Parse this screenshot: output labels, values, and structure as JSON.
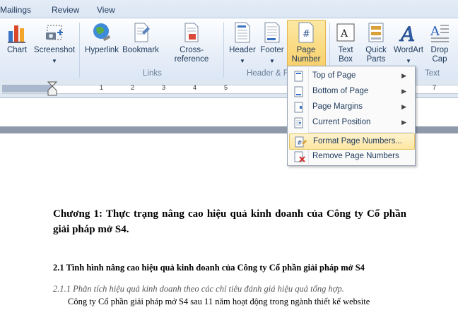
{
  "tabs": [
    "Mailings",
    "Review",
    "View"
  ],
  "ribbon": {
    "buttons": {
      "chart": "Chart",
      "screenshot": "Screenshot",
      "hyperlink": "Hyperlink",
      "bookmark": "Bookmark",
      "cross_reference": "Cross-reference",
      "header": "Header",
      "footer": "Footer",
      "page_number_line1": "Page",
      "page_number_line2": "Number",
      "text_box_line1": "Text",
      "text_box_line2": "Box",
      "quick_parts_line1": "Quick",
      "quick_parts_line2": "Parts",
      "wordart": "WordArt",
      "drop_cap_line1": "Drop",
      "drop_cap_line2": "Cap"
    },
    "groups": {
      "links": "Links",
      "header_footer": "Header & F",
      "text": "Text"
    },
    "colors": {
      "highlight": "#f8d06b",
      "accent": "#1e395b"
    }
  },
  "ruler": {
    "numbers": [
      "1",
      "2",
      "3",
      "4",
      "5",
      "7"
    ]
  },
  "menu": {
    "items": [
      {
        "label": "Top of Page",
        "icon": "page-top-icon",
        "submenu": true
      },
      {
        "label": "Bottom of Page",
        "icon": "page-bottom-icon",
        "submenu": true
      },
      {
        "label": "Page Margins",
        "icon": "page-margins-icon",
        "submenu": true
      },
      {
        "label": "Current Position",
        "icon": "current-position-icon",
        "submenu": true
      },
      {
        "label": "Format Page Numbers...",
        "icon": "format-page-numbers-icon",
        "submenu": false,
        "selected": true
      },
      {
        "label": "Remove Page Numbers",
        "icon": "remove-page-numbers-icon",
        "submenu": false
      }
    ]
  },
  "document": {
    "heading1": "Chương 1: Thực trạng nâng cao hiệu quả kinh doanh của Công ty Cổ phần giải pháp mở S4.",
    "heading2": "2.1 Tình hình nâng cao hiệu quả kinh doanh của Công ty Cổ phần giải pháp mở S4",
    "heading3": "2.1.1 Phân tích hiệu quả kinh doanh theo các chỉ tiêu đánh giá hiệu quả tổng hợp.",
    "paragraph": "Công ty Cổ phần giải pháp mở S4 sau 11 năm hoạt động trong ngành thiết kế website"
  }
}
